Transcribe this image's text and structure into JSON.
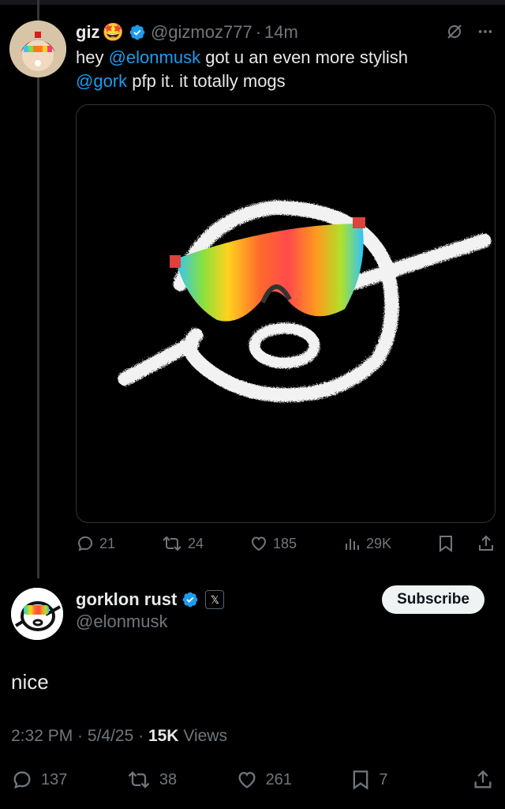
{
  "tweet1": {
    "display_name": "giz",
    "name_emoji": "🤩",
    "handle": "@gizmoz777",
    "separator": "·",
    "time": "14m",
    "text_parts": {
      "p1": "hey ",
      "m1": "@elonmusk",
      "p2": " got u an even more stylish",
      "m2": "@gork",
      "p3": " pfp it. it totally mogs"
    },
    "stats": {
      "replies": "21",
      "reposts": "24",
      "likes": "185",
      "views": "29K"
    }
  },
  "tweet2": {
    "display_name": "gorklon rust",
    "affiliate_badge": "𝕏",
    "handle": "@elonmusk",
    "subscribe_label": "Subscribe",
    "text": "nice",
    "meta": {
      "time": "2:32 PM",
      "sep1": " · ",
      "date": "5/4/25",
      "sep2": " · ",
      "views_count": "15K",
      "views_label": " Views"
    },
    "stats": {
      "replies": "137",
      "reposts": "38",
      "likes": "261",
      "bookmarks": "7"
    }
  },
  "colors": {
    "link": "#1d9bf0",
    "muted": "#71767b",
    "text": "#e7e9ea",
    "verified": "#1d9bf0"
  },
  "icons": [
    "grok-icon",
    "more-icon",
    "reply-icon",
    "repost-icon",
    "like-icon",
    "views-icon",
    "bookmark-icon",
    "share-icon",
    "verified-icon"
  ]
}
